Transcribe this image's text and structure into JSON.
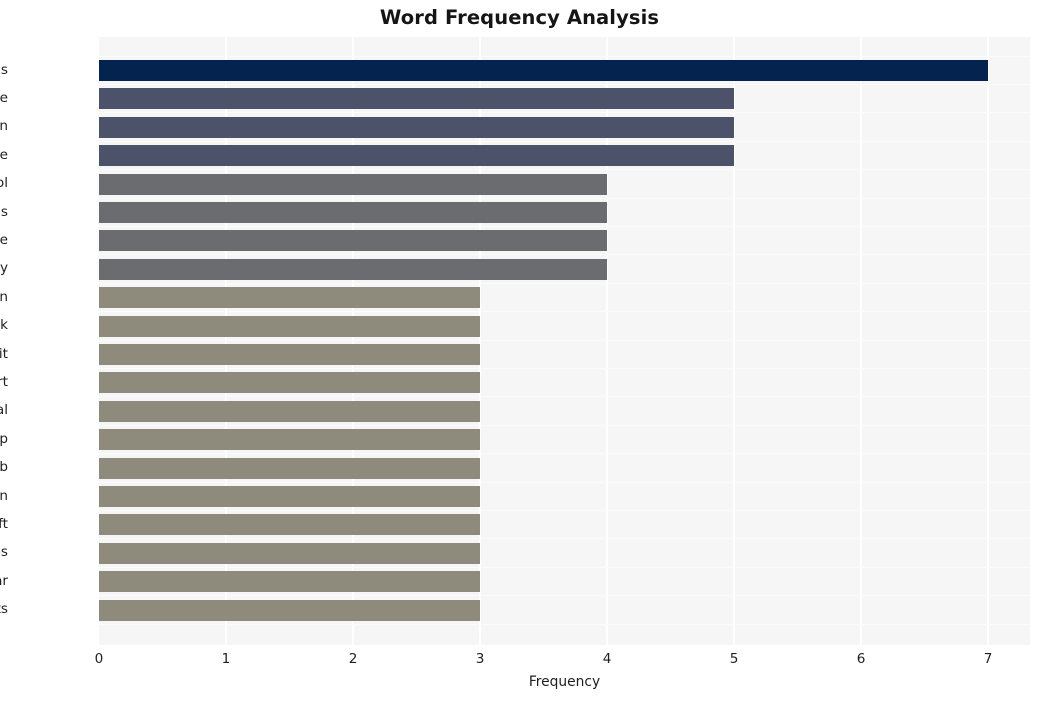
{
  "chart_data": {
    "type": "bar",
    "orientation": "horizontal",
    "title": "Word Frequency Analysis",
    "xlabel": "Frequency",
    "ylabel": "",
    "categories": [
      "caigns",
      "like",
      "train",
      "wire",
      "tool",
      "politics",
      "google",
      "company",
      "biden",
      "week",
      "edit",
      "start",
      "political",
      "help",
      "lab",
      "begin",
      "microsoft",
      "workshops",
      "year",
      "participants"
    ],
    "values": [
      7,
      5,
      5,
      5,
      4,
      4,
      4,
      4,
      3,
      3,
      3,
      3,
      3,
      3,
      3,
      3,
      3,
      3,
      3,
      3
    ],
    "bar_colors": [
      "#04234f",
      "#4b5269",
      "#4b5269",
      "#4b5269",
      "#6b6c70",
      "#6b6c70",
      "#6b6c70",
      "#6b6c70",
      "#8e8a7c",
      "#8e8a7c",
      "#8e8a7c",
      "#8e8a7c",
      "#8e8a7c",
      "#8e8a7c",
      "#8e8a7c",
      "#8e8a7c",
      "#8e8a7c",
      "#8e8a7c",
      "#8e8a7c",
      "#8e8a7c"
    ],
    "xticks": [
      0,
      1,
      2,
      3,
      4,
      5,
      6,
      7
    ],
    "xtick_labels": [
      "0",
      "1",
      "2",
      "3",
      "4",
      "5",
      "6",
      "7"
    ],
    "xlim": [
      0,
      7.33
    ],
    "grid": true,
    "grid_color": "#ffffff",
    "legend": null,
    "plot_background": "#f6f6f7",
    "figure_background": "#ffffff"
  }
}
